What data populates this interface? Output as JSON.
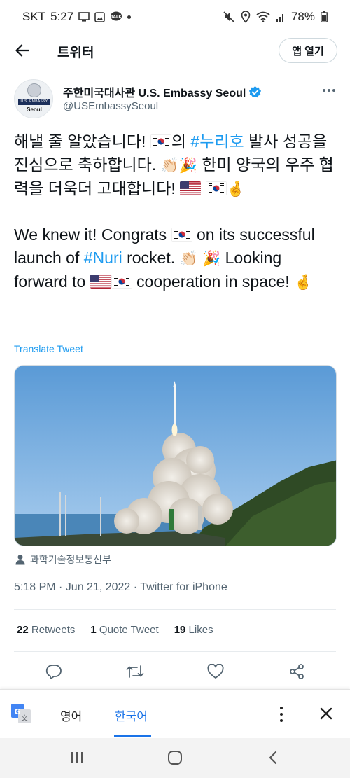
{
  "status_bar": {
    "carrier": "SKT",
    "time": "5:27",
    "battery": "78%"
  },
  "header": {
    "title": "트위터",
    "open_app_label": "앱 열기"
  },
  "author": {
    "display_name": "주한미국대사관 U.S. Embassy Seoul",
    "handle": "@USEmbassySeoul",
    "avatar_banner": "U.S. EMBASSY",
    "avatar_city": "Seoul"
  },
  "tweet": {
    "ko": {
      "p1": "해낼 줄 알았습니다! ",
      "p2": "의 ",
      "hashtag": "#누리호",
      "p3": " 발사 성공을 진심으로 축하합니다. ",
      "emoji_clap": "👏🏻",
      "emoji_party": "🎉",
      "p4": " 한미 양국의 우주 협력을 더욱더 고대합니다! ",
      "emoji_cross": "🤞"
    },
    "en": {
      "p1": "We knew it! Congrats ",
      "p2": " on its successful launch of ",
      "hashtag": "#Nuri",
      "p3": " rocket. ",
      "emoji_clap": "👏🏻",
      "emoji_party": "🎉",
      "p4": "  Looking forward to ",
      "p5": " cooperation in space! ",
      "emoji_cross": "🤞"
    },
    "translate_label": "Translate Tweet",
    "media_caption": "과학기술정보통신부",
    "timestamp": "5:18 PM · Jun 21, 2022 · Twitter for iPhone"
  },
  "stats": {
    "retweets_count": "22",
    "retweets_label": "Retweets",
    "quotes_count": "1",
    "quotes_label": "Quote Tweet",
    "likes_count": "19",
    "likes_label": "Likes"
  },
  "translate_bar": {
    "source_lang": "영어",
    "target_lang": "한국어"
  },
  "colors": {
    "accent": "#1d9bf0",
    "text": "#0f1419",
    "muted": "#536471",
    "google_blue": "#1a73e8"
  },
  "icons": [
    "back-arrow-icon",
    "verified-badge-icon",
    "more-icon",
    "person-icon",
    "reply-icon",
    "retweet-icon",
    "like-icon",
    "share-icon",
    "google-translate-icon",
    "close-icon"
  ]
}
